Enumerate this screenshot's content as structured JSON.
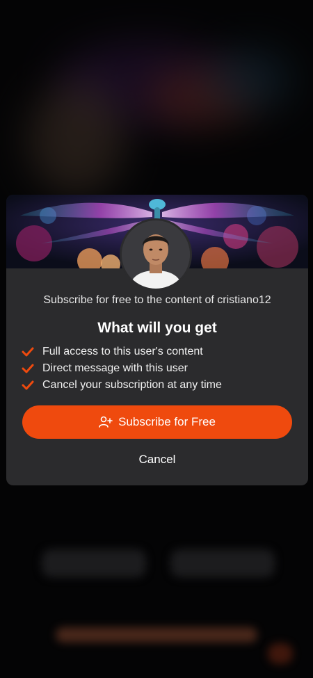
{
  "modal": {
    "subtitle": "Subscribe for free to the content of cristiano12",
    "heading": "What will you get",
    "benefits": [
      {
        "label": "Full access to this user's content"
      },
      {
        "label": "Direct message with this user"
      },
      {
        "label": "Cancel your subscription at any time"
      }
    ],
    "subscribe_label": "Subscribe for Free",
    "subscribe_icon": "add-user-icon",
    "cancel_label": "Cancel",
    "check_icon": "check-icon",
    "accent_color": "#ef4a0e",
    "card_color": "#2b2b2d"
  }
}
